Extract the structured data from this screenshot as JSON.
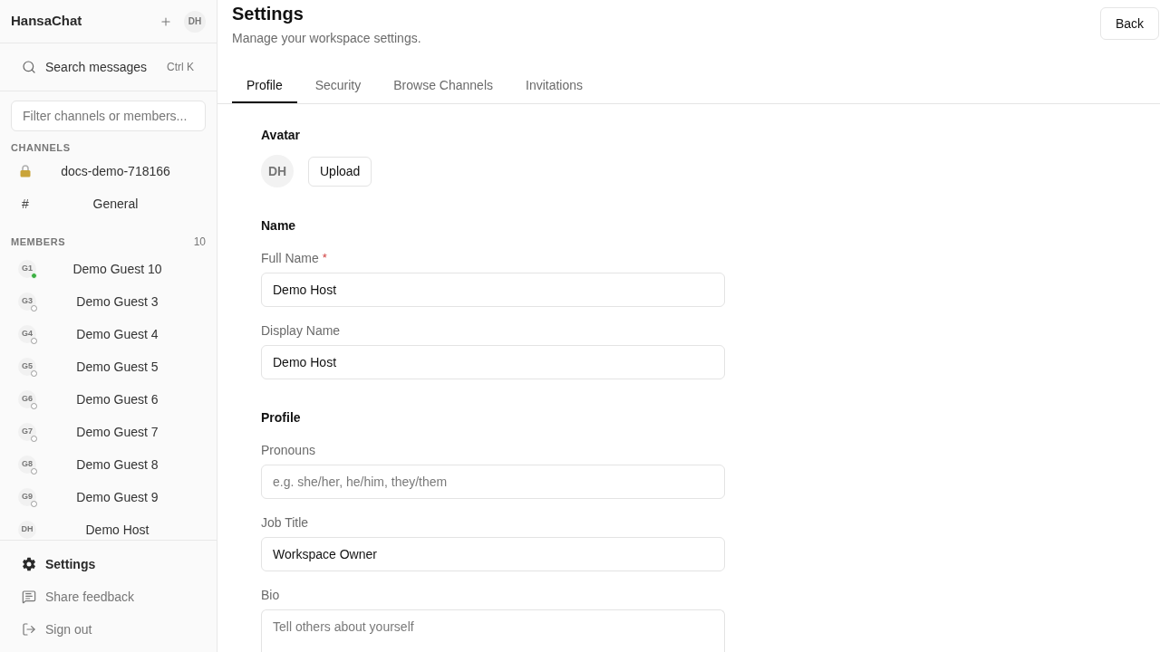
{
  "sidebar": {
    "app_name": "HansaChat",
    "user_initials": "DH",
    "search": {
      "label": "Search messages",
      "shortcut": "Ctrl K"
    },
    "filter": {
      "placeholder": "Filter channels or members..."
    },
    "channels_heading": "CHANNELS",
    "channels": [
      {
        "kind": "private",
        "name": "docs-demo-718166"
      },
      {
        "kind": "public",
        "symbol": "#",
        "name": "General"
      }
    ],
    "members_heading": "MEMBERS",
    "members_count": "10",
    "members": [
      {
        "initials": "G1",
        "name": "Demo Guest 10",
        "online": true
      },
      {
        "initials": "G3",
        "name": "Demo Guest 3",
        "online": false
      },
      {
        "initials": "G4",
        "name": "Demo Guest 4",
        "online": false
      },
      {
        "initials": "G5",
        "name": "Demo Guest 5",
        "online": false
      },
      {
        "initials": "G6",
        "name": "Demo Guest 6",
        "online": false
      },
      {
        "initials": "G7",
        "name": "Demo Guest 7",
        "online": false
      },
      {
        "initials": "G8",
        "name": "Demo Guest 8",
        "online": false
      },
      {
        "initials": "G9",
        "name": "Demo Guest 9",
        "online": false
      },
      {
        "initials": "DH",
        "name": "Demo Host"
      }
    ],
    "footer": [
      {
        "kind": "settings",
        "label": "Settings",
        "selected": true
      },
      {
        "kind": "feedback",
        "label": "Share feedback",
        "selected": false
      },
      {
        "kind": "signout",
        "label": "Sign out",
        "selected": false
      }
    ]
  },
  "header": {
    "title": "Settings",
    "subtitle": "Manage your workspace settings.",
    "back_button": "Back"
  },
  "tabs": [
    {
      "label": "Profile",
      "selected": true
    },
    {
      "label": "Security",
      "selected": false
    },
    {
      "label": "Browse Channels",
      "selected": false
    },
    {
      "label": "Invitations",
      "selected": false
    }
  ],
  "profile": {
    "avatar": {
      "heading": "Avatar",
      "initials": "DH",
      "upload_button": "Upload"
    },
    "sections": [
      {
        "heading": "Name",
        "fields": [
          {
            "kind": "input",
            "label": "Full Name",
            "required_mark": "*",
            "value": "Demo Host"
          },
          {
            "kind": "input",
            "label": "Display Name",
            "value": "Demo Host"
          }
        ]
      },
      {
        "heading": "Profile",
        "fields": [
          {
            "kind": "input",
            "label": "Pronouns",
            "placeholder": "e.g. she/her, he/him, they/them"
          },
          {
            "kind": "input",
            "label": "Job Title",
            "value": "Workspace Owner"
          },
          {
            "kind": "textarea",
            "label": "Bio",
            "placeholder": "Tell others about yourself"
          }
        ]
      }
    ]
  }
}
